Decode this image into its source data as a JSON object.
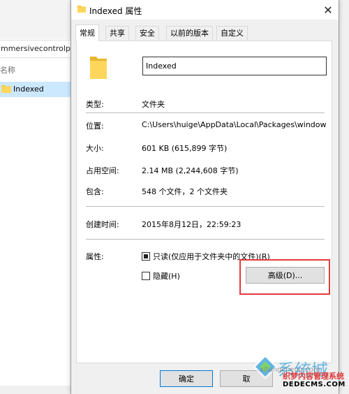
{
  "background_explorer": {
    "address_text": "mmersivecontrolpa",
    "column_header": "名称",
    "selected_item": "Indexed"
  },
  "dialog": {
    "title": "Indexed 属性",
    "close_glyph": "✕",
    "tabs": [
      {
        "label": "常规",
        "active": true
      },
      {
        "label": "共享",
        "active": false
      },
      {
        "label": "安全",
        "active": false
      },
      {
        "label": "以前的版本",
        "active": false
      },
      {
        "label": "自定义",
        "active": false
      }
    ],
    "name_value": "Indexed",
    "fields": {
      "type_label": "类型:",
      "type_value": "文件夹",
      "location_label": "位置:",
      "location_value": "C:\\Users\\huige\\AppData\\Local\\Packages\\window",
      "size_label": "大小:",
      "size_value": "601 KB (615,899 字节)",
      "disk_label": "占用空间:",
      "disk_value": "2.14 MB (2,244,608 字节)",
      "contains_label": "包含:",
      "contains_value": "548 个文件，2 个文件夹",
      "created_label": "创建时间:",
      "created_value": "2015年8月12日，22:59:23",
      "attributes_label": "属性:"
    },
    "attributes": {
      "readonly_label": "只读(仅应用于文件夹中的文件)(R)",
      "readonly_state": "indeterminate",
      "hidden_label": "隐藏(H)",
      "hidden_checked": false,
      "advanced_button": "高级(D)..."
    },
    "buttons": {
      "ok": "确定",
      "cancel": "取"
    },
    "colors": {
      "highlight_box": "#e23a3a",
      "ok_border": "#0078d7"
    }
  },
  "watermark": {
    "cn_text": "系统城",
    "sub_text": "xitongcheng.com",
    "brand": "织梦内容管理系统",
    "url": "DEDECMS.COM"
  }
}
